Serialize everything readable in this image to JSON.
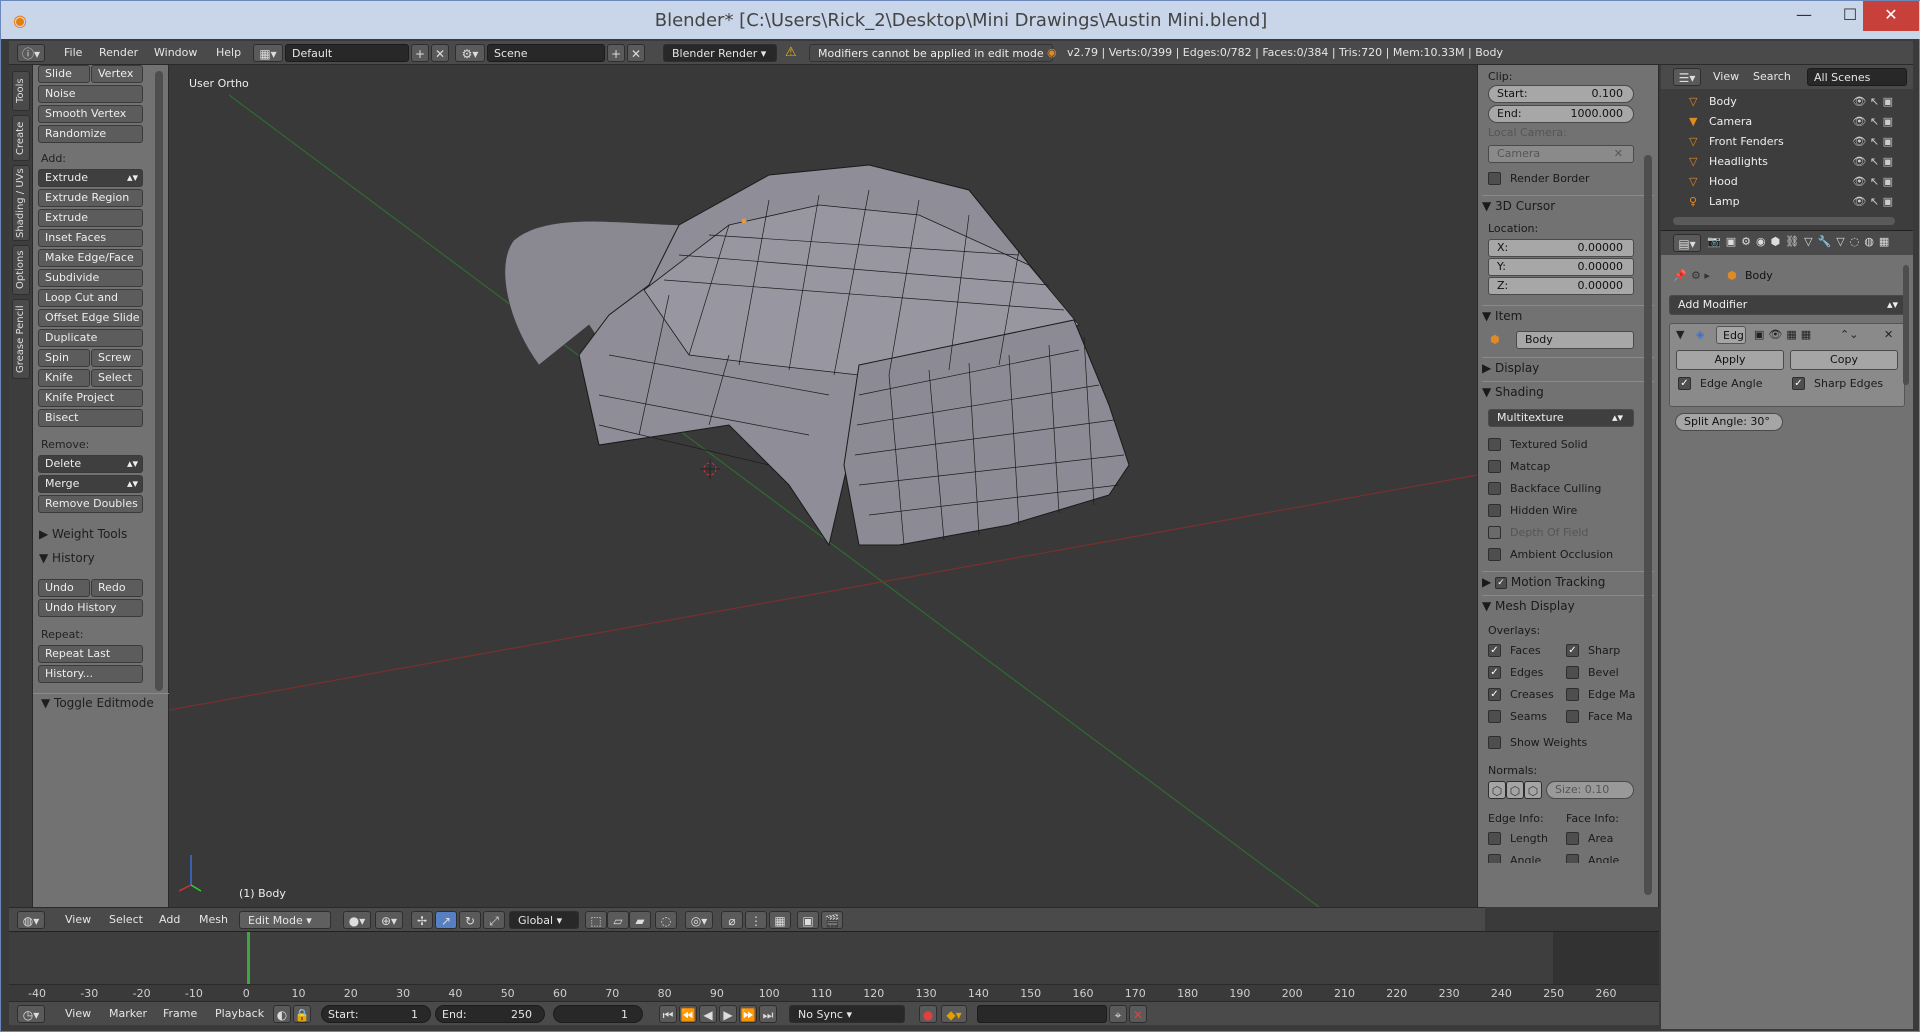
{
  "title": "Blender* [C:\\Users\\Rick_2\\Desktop\\Mini Drawings\\Austin Mini.blend]",
  "window_controls": {
    "minimize": "—",
    "maximize": "☐",
    "close": "✕"
  },
  "menu": [
    "File",
    "Render",
    "Window",
    "Help"
  ],
  "screen_layout": "Default",
  "scene": "Scene",
  "render_engine": "Blender Render",
  "warning": "Modifiers cannot be applied in edit mode",
  "stats": "v2.79 | Verts:0/399 | Edges:0/782 | Faces:0/384 | Tris:720 | Mem:10.33M | Body",
  "left_tabs": [
    "Tools",
    "Create",
    "Shading / UVs",
    "Options",
    "Grease Pencil"
  ],
  "tool_shelf": {
    "top_buttons": [
      [
        "Slide Ed",
        "Vertex"
      ]
    ],
    "deform": [
      "Noise",
      "Smooth Vertex",
      "Randomize"
    ],
    "add_label": "Add:",
    "add": [
      "Extrude",
      "Extrude Region",
      "Extrude Individual",
      "Inset Faces",
      "Make Edge/Face",
      "Subdivide",
      "Loop Cut and Slide",
      "Offset Edge Slide",
      "Duplicate"
    ],
    "add_pairs": [
      [
        "Spin",
        "Screw"
      ],
      [
        "Knife",
        "Select"
      ]
    ],
    "add_more": [
      "Knife Project",
      "Bisect"
    ],
    "remove_label": "Remove:",
    "remove": [
      "Delete",
      "Merge",
      "Remove Doubles"
    ],
    "weight_tools": "Weight Tools",
    "history": "History",
    "undo": "Undo",
    "redo": "Redo",
    "undo_history": "Undo History",
    "repeat_label": "Repeat:",
    "repeat_last": "Repeat Last",
    "history_btn": "History...",
    "toggle_editmode": "Toggle Editmode"
  },
  "viewport": {
    "label": "User Ortho",
    "object": "(1) Body"
  },
  "viewport_header": {
    "menus": [
      "View",
      "Select",
      "Add",
      "Mesh"
    ],
    "mode": "Edit Mode",
    "orientation": "Global"
  },
  "properties_panel": {
    "clip": "Clip:",
    "start_label": "Start:",
    "start": "0.100",
    "end_label": "End:",
    "end": "1000.000",
    "local_camera": "Local Camera:",
    "camera": "Camera",
    "render_border": "Render Border",
    "cursor": "3D Cursor",
    "location": "Location:",
    "x_label": "X:",
    "x": "0.00000",
    "y_label": "Y:",
    "y": "0.00000",
    "z_label": "Z:",
    "z": "0.00000",
    "item": "Item",
    "item_name": "Body",
    "display": "Display",
    "shading": "Shading",
    "shading_mode": "Multitexture",
    "shading_opts": [
      "Textured Solid",
      "Matcap",
      "Backface Culling",
      "Hidden Wire",
      "Depth Of Field",
      "Ambient Occlusion"
    ],
    "motion_tracking": "Motion Tracking",
    "mesh_display": "Mesh Display",
    "overlays": "Overlays:",
    "overlay_left": [
      "Faces",
      "Edges",
      "Creases",
      "Seams"
    ],
    "overlay_right": [
      "Sharp",
      "Bevel",
      "Edge Ma",
      "Face Ma"
    ],
    "show_weights": "Show Weights",
    "normals": "Normals:",
    "normal_size": "Size:  0.10",
    "edge_info": "Edge Info:",
    "face_info": "Face Info:",
    "edge_info_opts": [
      "Length",
      "Angle"
    ],
    "face_info_opts": [
      "Area",
      "Angle"
    ]
  },
  "outliner": {
    "menus": [
      "View",
      "Search"
    ],
    "filter": "All Scenes",
    "items": [
      "Body",
      "Camera",
      "Front Fenders",
      "Headlights",
      "Hood",
      "Lamp"
    ]
  },
  "modifier_panel": {
    "object": "Body",
    "add_modifier": "Add Modifier",
    "modifier_name": "Edg",
    "apply": "Apply",
    "copy": "Copy",
    "edge_angle": "Edge Angle",
    "sharp_edges": "Sharp Edges",
    "split_angle": "Split Angle: 30°"
  },
  "timeline": {
    "ticks": [
      "-40",
      "-30",
      "-20",
      "-10",
      "0",
      "10",
      "20",
      "30",
      "40",
      "50",
      "60",
      "70",
      "80",
      "90",
      "100",
      "110",
      "120",
      "130",
      "140",
      "150",
      "160",
      "170",
      "180",
      "190",
      "200",
      "210",
      "220",
      "230",
      "240",
      "250",
      "260"
    ],
    "menus": [
      "View",
      "Marker",
      "Frame",
      "Playback"
    ],
    "start": "Start:",
    "start_val": "1",
    "end": "End:",
    "end_val": "250",
    "current": "1",
    "sync": "No Sync"
  }
}
